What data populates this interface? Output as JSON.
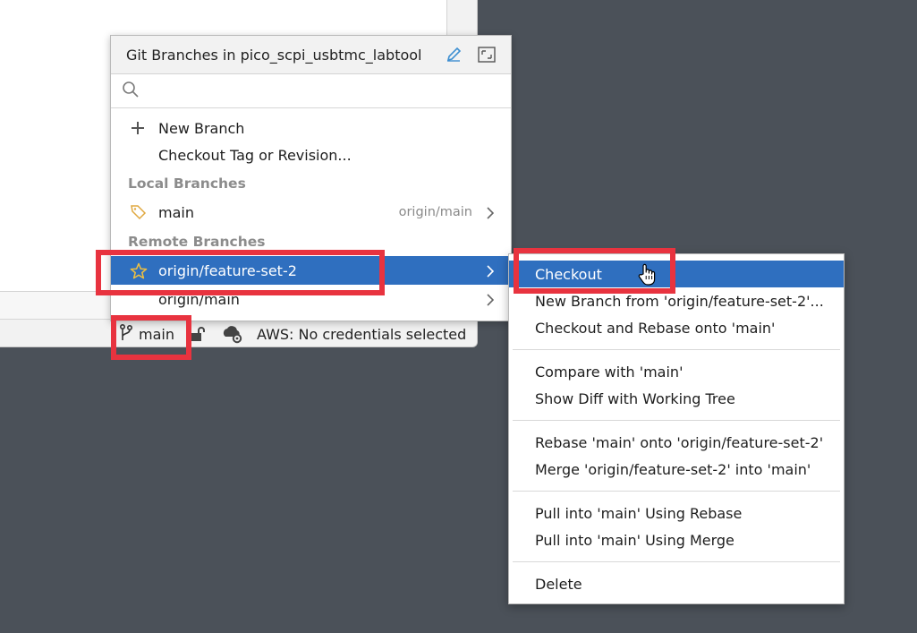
{
  "popup": {
    "title": "Git Branches in pico_scpi_usbtmc_labtool",
    "search_placeholder": "",
    "actions": [
      {
        "label": "New Branch",
        "icon": "plus-icon"
      },
      {
        "label": "Checkout Tag or Revision..."
      }
    ],
    "local_section_label": "Local Branches",
    "local_branches": [
      {
        "name": "main",
        "tracking": "origin/main",
        "icon": "tag-icon"
      }
    ],
    "remote_section_label": "Remote Branches",
    "remote_branches": [
      {
        "name": "origin/feature-set-2",
        "icon": "star-icon",
        "selected": true
      },
      {
        "name": "origin/main"
      }
    ]
  },
  "statusbar": {
    "branch": "main",
    "aws": "AWS: No credentials selected"
  },
  "submenu": {
    "items": [
      "Checkout",
      "New Branch from 'origin/feature-set-2'...",
      "Checkout and Rebase onto 'main'",
      "Compare with 'main'",
      "Show Diff with Working Tree",
      "Rebase 'main' onto 'origin/feature-set-2'",
      "Merge 'origin/feature-set-2' into 'main'",
      "Pull into 'main' Using Rebase",
      "Pull into 'main' Using Merge",
      "Delete"
    ]
  },
  "colors": {
    "selection": "#2f6fbf",
    "highlight_box": "#e8333f",
    "background": "#4b5159"
  }
}
